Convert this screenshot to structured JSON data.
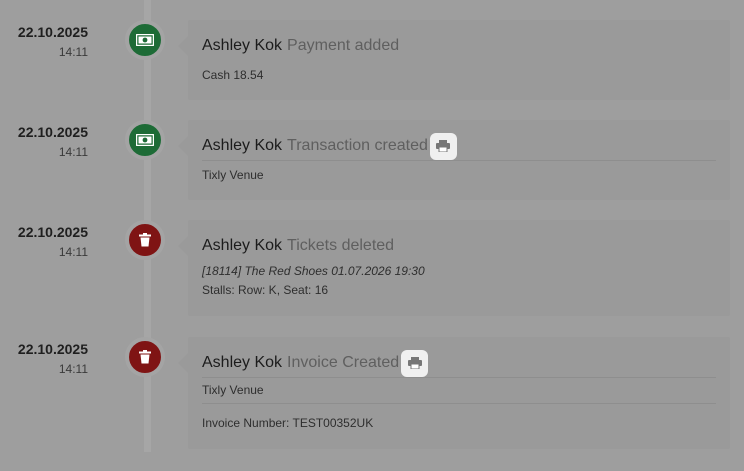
{
  "colors": {
    "payment_badge": "#1d6b36",
    "delete_badge": "#7f1414",
    "background": "#9e9e9e"
  },
  "entries": [
    {
      "date": "22.10.2025",
      "time": "14:11",
      "icon": "banknote-icon",
      "user": "Ashley Kok",
      "action": "Payment added",
      "details": [
        "Cash 18.54"
      ]
    },
    {
      "date": "22.10.2025",
      "time": "14:11",
      "icon": "banknote-icon",
      "user": "Ashley Kok",
      "action": "Transaction created",
      "print_icon": "printer-icon",
      "details": [
        "Tixly Venue"
      ]
    },
    {
      "date": "22.10.2025",
      "time": "14:11",
      "icon": "trash-icon",
      "user": "Ashley Kok",
      "action": "Tickets deleted",
      "details": [
        "[18114] The Red Shoes 01.07.2026 19:30",
        "Stalls: Row: K, Seat: 16"
      ]
    },
    {
      "date": "22.10.2025",
      "time": "14:11",
      "icon": "trash-icon",
      "user": "Ashley Kok",
      "action": "Invoice Created",
      "print_icon": "printer-icon",
      "details": [
        "Tixly Venue",
        "Invoice Number: TEST00352UK"
      ]
    }
  ]
}
